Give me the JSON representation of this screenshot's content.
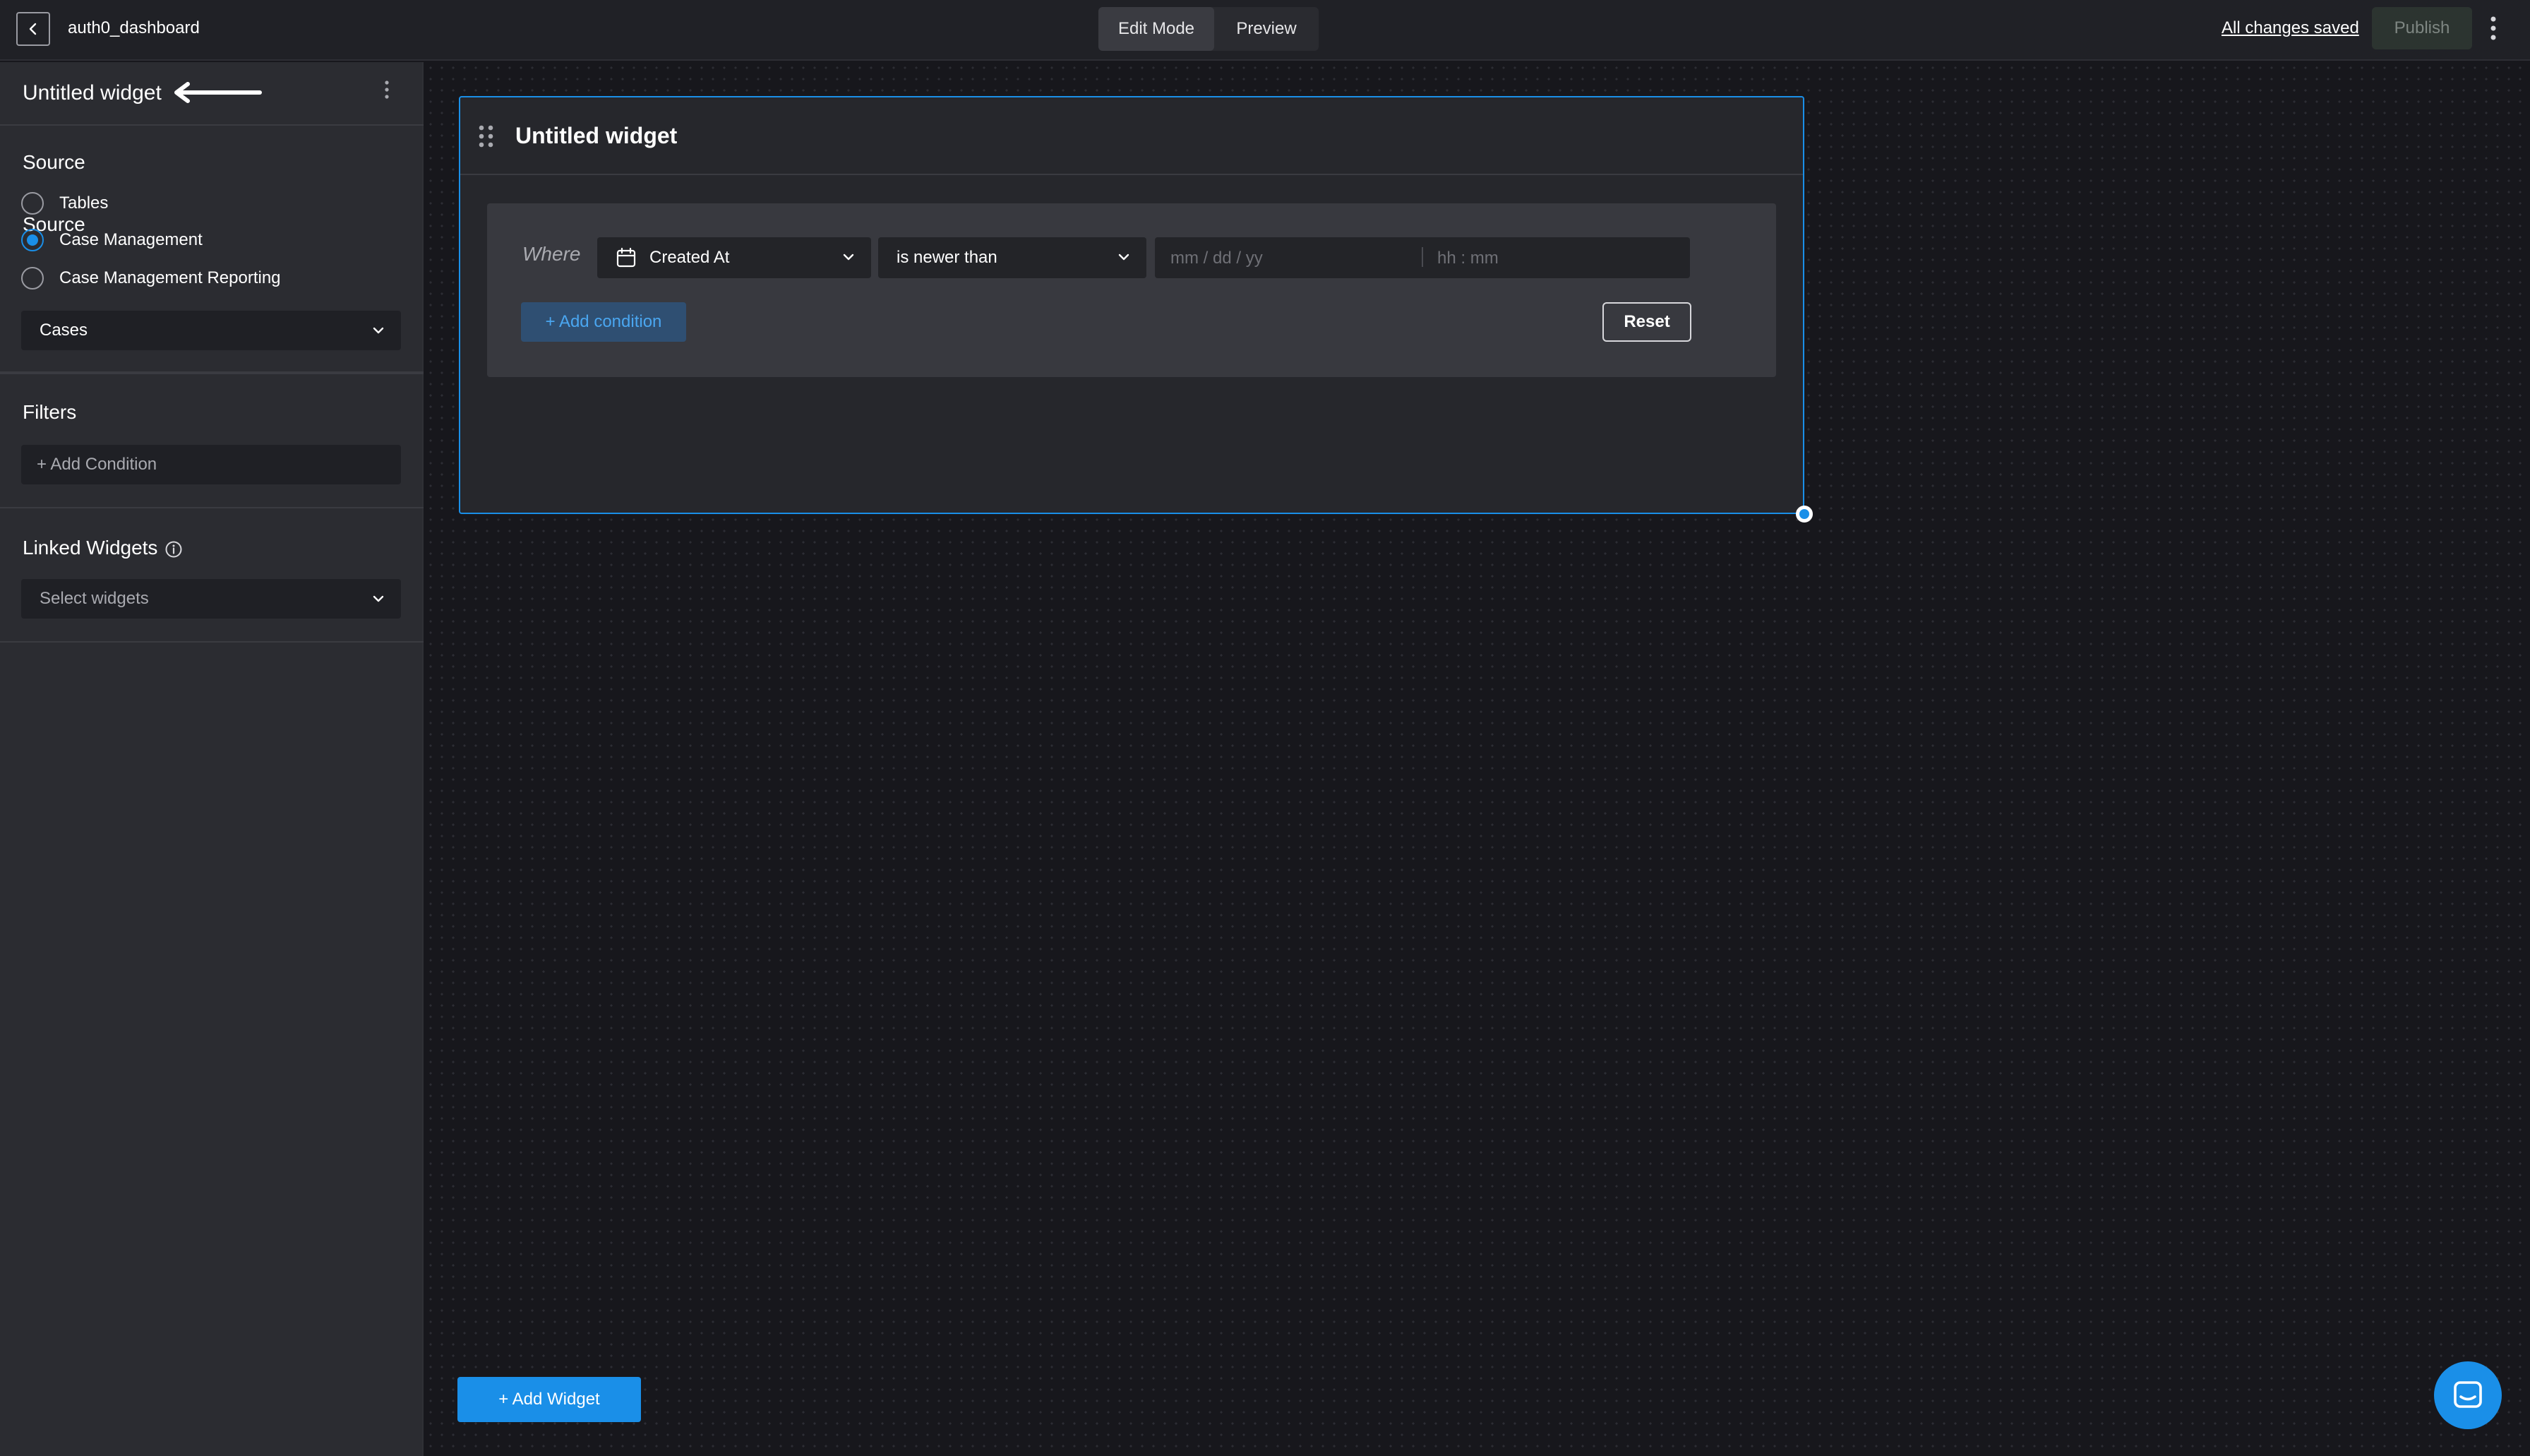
{
  "topbar": {
    "title": "auth0_dashboard",
    "modes": [
      "Edit Mode",
      "Preview"
    ],
    "active_mode": "Edit Mode",
    "save_status": "All changes saved",
    "publish_label": "Publish"
  },
  "panel": {
    "widget_name": "Untitled widget",
    "source": {
      "title": "Source",
      "options": [
        "Tables",
        "Case Management",
        "Case Management Reporting"
      ],
      "selected": "Case Management",
      "dataset": "Cases"
    },
    "filters": {
      "title": "Filters",
      "add_label": "+ Add Condition"
    },
    "linked": {
      "title": "Linked Widgets",
      "placeholder": "Select widgets"
    }
  },
  "widget": {
    "title": "Untitled widget",
    "where_label": "Where",
    "field": "Created At",
    "operator": "is newer than",
    "date_placeholder": "mm / dd / yy",
    "time_placeholder": "hh : mm",
    "add_condition_label": "+ Add condition",
    "reset_label": "Reset"
  },
  "canvas": {
    "add_widget_label": "+ Add Widget"
  },
  "colors": {
    "accent": "#1a8fe8",
    "background": "#17171c",
    "panel": "#2b2c31"
  },
  "icons": [
    "chevron-left-icon",
    "kebab-icon",
    "arrow-left-icon",
    "chevron-down-icon",
    "info-icon",
    "drag-handle-icon",
    "calendar-icon",
    "chat-icon"
  ]
}
